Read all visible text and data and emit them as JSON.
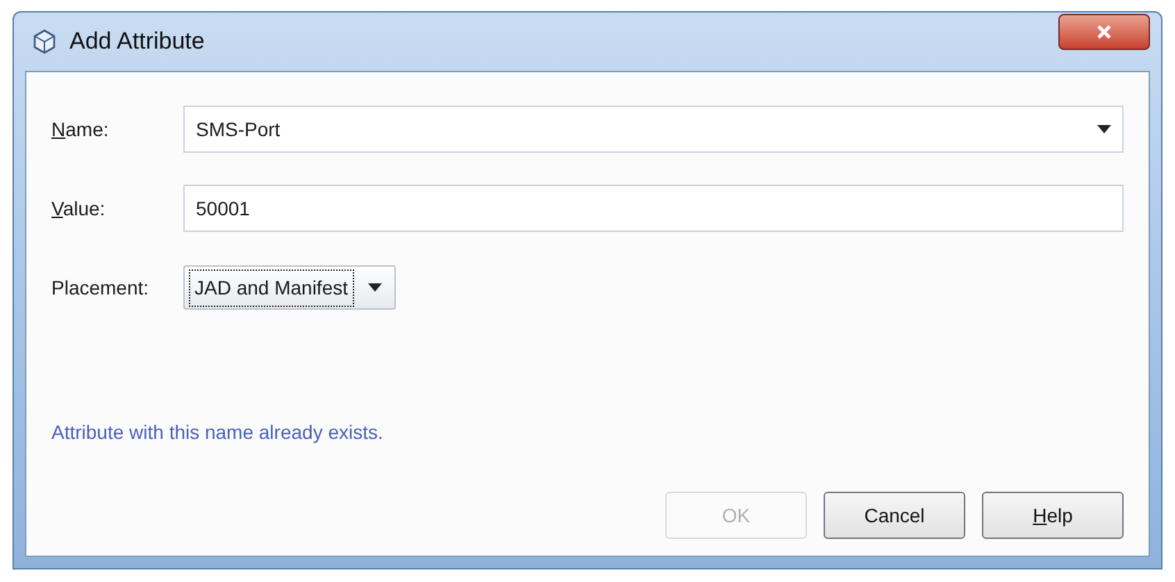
{
  "window": {
    "title": "Add Attribute"
  },
  "fields": [
    {
      "kind": "combo",
      "label": "Name:",
      "mnemonic": true,
      "value": "SMS-Port"
    },
    {
      "kind": "text",
      "label": "Value:",
      "mnemonic": true,
      "value": "50001"
    },
    {
      "kind": "dropdown",
      "label": "Placement:",
      "value": "JAD and Manifest",
      "focused": true
    }
  ],
  "message": "Attribute with this name already exists.",
  "buttons": [
    {
      "label": "OK",
      "disabled": true
    },
    {
      "label": "Cancel",
      "disabled": false
    },
    {
      "label": "Help",
      "disabled": false,
      "mnemonic": true
    }
  ]
}
